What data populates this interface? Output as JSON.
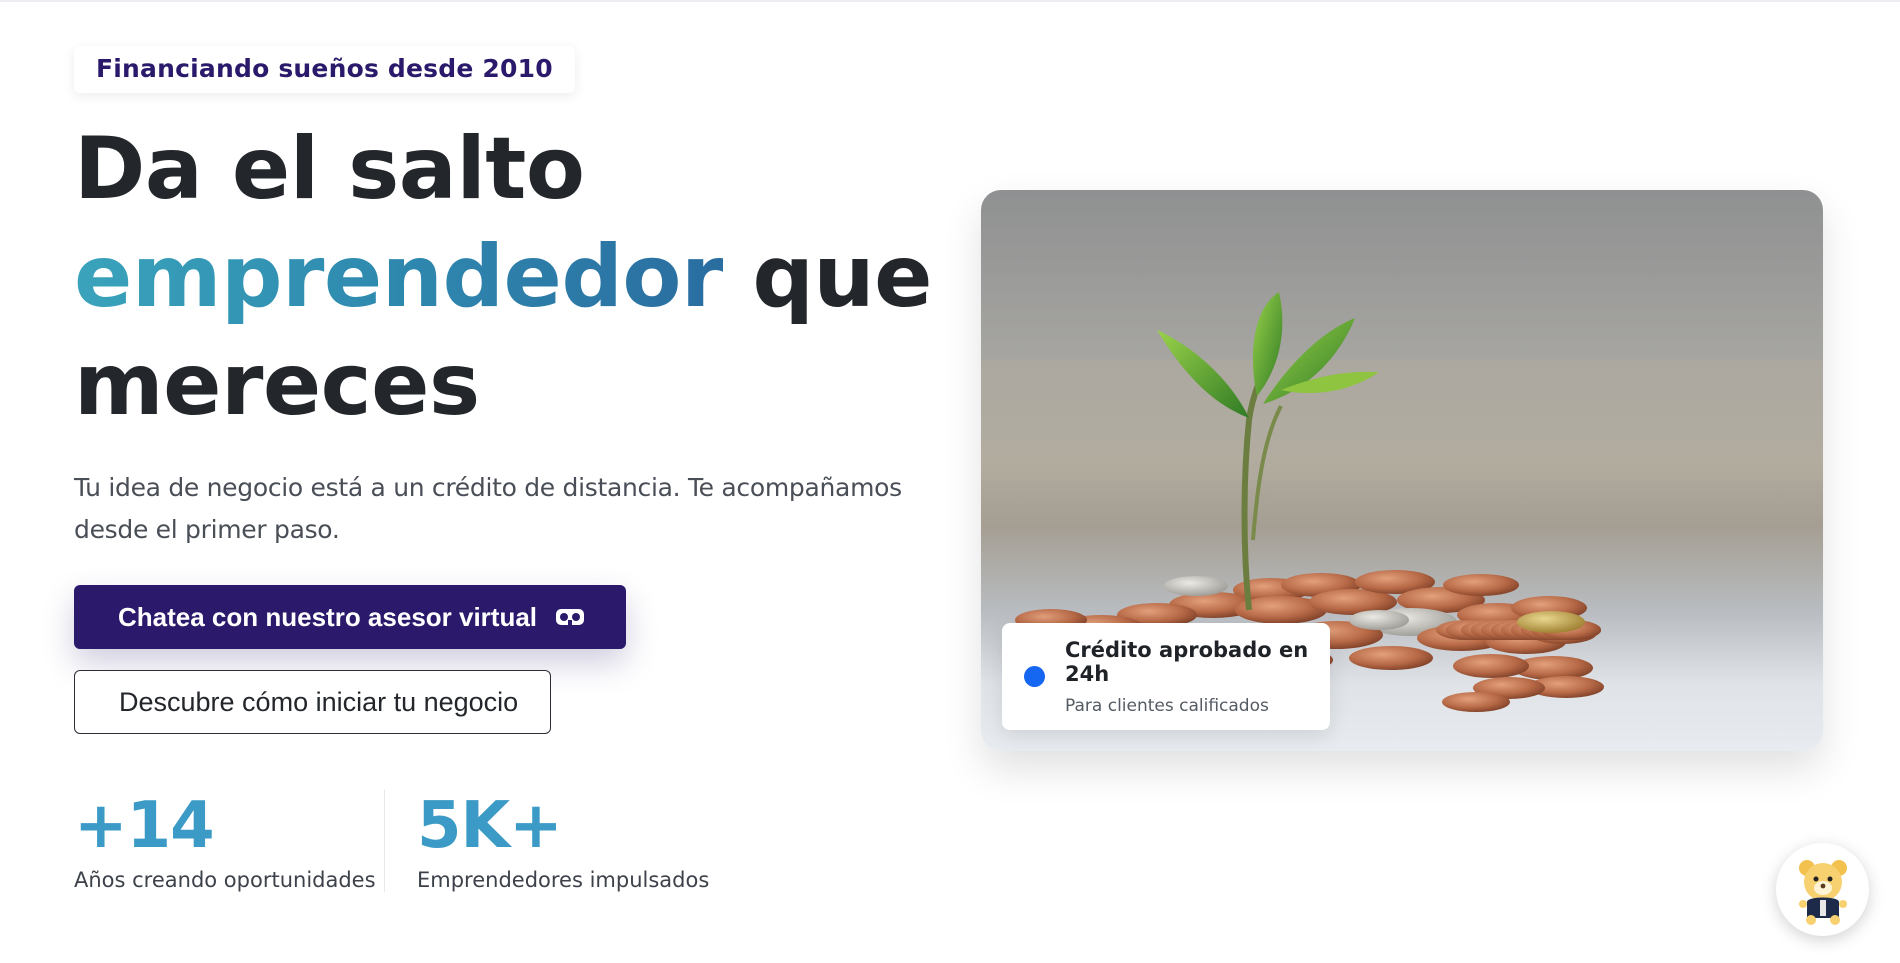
{
  "hero": {
    "eyebrow": "Financiando sueños desde 2010",
    "headline_line1": "Da el salto",
    "headline_accent": "emprendedor",
    "headline_after_accent": " que",
    "headline_line3": "mereces",
    "subtitle": "Tu idea de negocio está a un crédito de distancia. Te acompañamos desde el primer paso.",
    "primary_cta": "Chatea con nuestro asesor virtual",
    "primary_cta_icon": "vr-headset-icon",
    "secondary_cta": "Descubre cómo iniciar tu negocio"
  },
  "stats": [
    {
      "value": "+14",
      "label": "Años creando oportunidades"
    },
    {
      "value": "5K+",
      "label": "Emprendedores impulsados"
    }
  ],
  "image_card": {
    "description_icon": "plant-growing-from-coins-image",
    "badge_title": "Crédito aprobado en 24h",
    "badge_subtitle": "Para clientes calificados"
  },
  "chat_widget": {
    "icon": "mascot-bear-icon"
  },
  "colors": {
    "brand_dark": "#2b1a6b",
    "accent_teal": "#3aa3bb",
    "accent_blue": "#2a6da0",
    "stat_blue": "#3c9bc6",
    "badge_dot": "#1566f0"
  }
}
